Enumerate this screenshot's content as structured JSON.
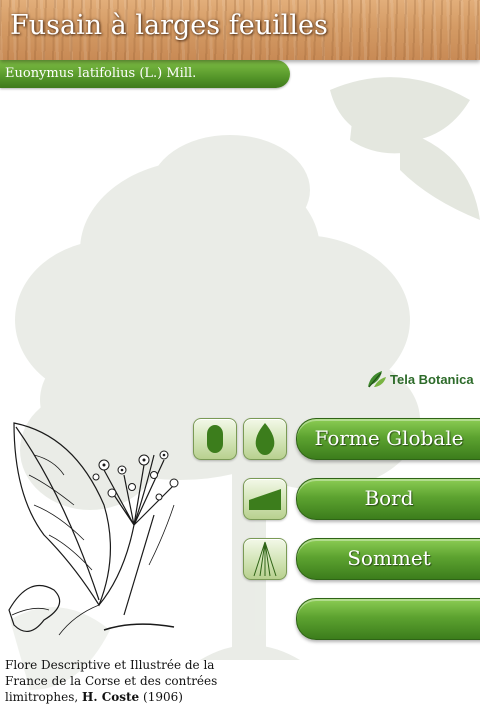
{
  "header": {
    "title": "Fusain à larges feuilles"
  },
  "species": {
    "latin_name": "Euonymus latifolius (L.) Mill."
  },
  "logo": {
    "text": "Tela Botanica",
    "icon": "tela-botanica-leaf-icon"
  },
  "criteria_buttons": [
    {
      "label": "Forme Globale",
      "icons": [
        "oval-leaf-shape-icon",
        "ovate-leaf-shape-icon"
      ]
    },
    {
      "label": "Bord",
      "icons": [
        "leaf-margin-icon"
      ]
    },
    {
      "label": "Sommet",
      "icons": [
        "leaf-apex-icon"
      ]
    },
    {
      "label": "",
      "icons": []
    }
  ],
  "illustration": {
    "caption_prefix": "Flore Descriptive et Illustrée de la France de la Corse et des contrées limitrophes,",
    "caption_author": "H. Coste",
    "caption_year": "(1906)"
  },
  "colors": {
    "accent_green": "#5da330",
    "wood": "#d49b65",
    "logo_green": "#2d6b2a"
  }
}
